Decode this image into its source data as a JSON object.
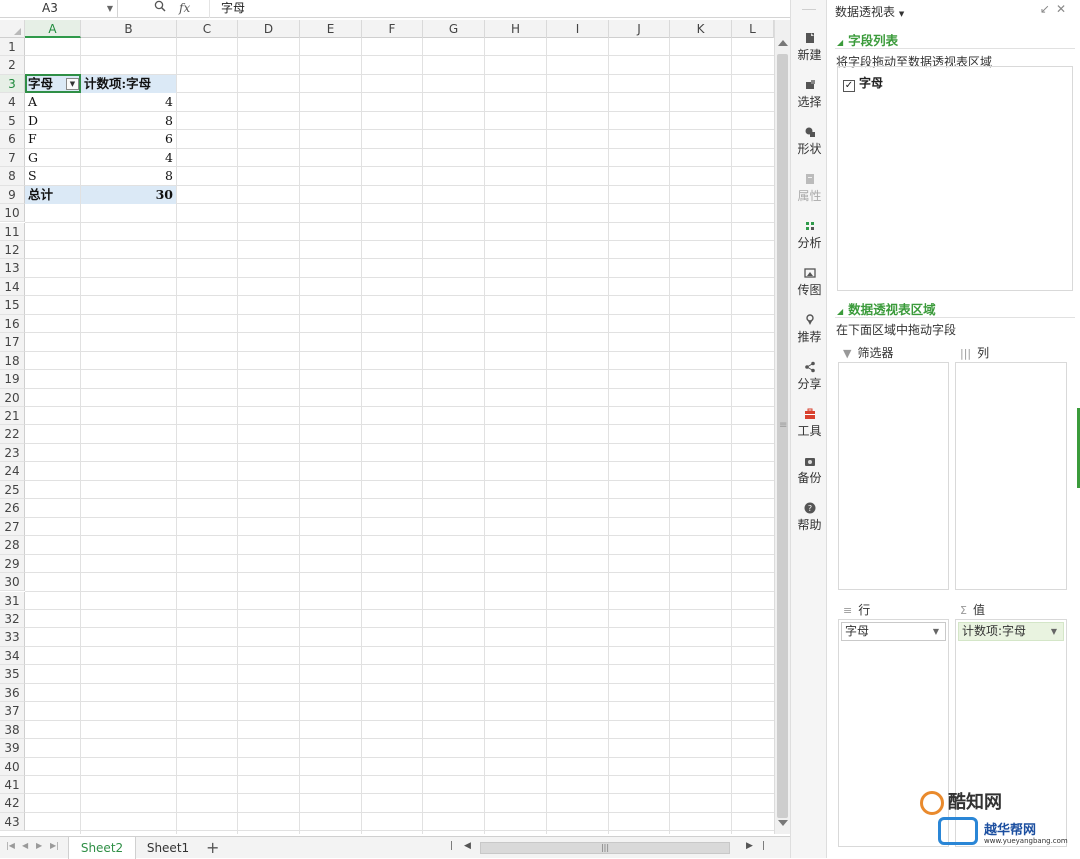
{
  "formula_bar": {
    "name_box": "A3",
    "zoom_icon": "zoom-icon",
    "fx_label": "fx",
    "formula_value": "字母"
  },
  "columns": [
    "A",
    "B",
    "C",
    "D",
    "E",
    "F",
    "G",
    "H",
    "I",
    "J",
    "K",
    "L"
  ],
  "rows": [
    "1",
    "2",
    "3",
    "4",
    "5",
    "6",
    "7",
    "8",
    "9",
    "10",
    "11",
    "12",
    "13",
    "14",
    "15",
    "16",
    "17",
    "18",
    "19",
    "20",
    "21",
    "22",
    "23",
    "24",
    "25",
    "26",
    "27",
    "28",
    "29",
    "30",
    "31",
    "32",
    "33",
    "34",
    "35",
    "36",
    "37",
    "38",
    "39",
    "40",
    "41",
    "42",
    "43"
  ],
  "active_cell": {
    "column": "A",
    "row": "3"
  },
  "pivot_table": {
    "header_row_label": "字母",
    "header_value_label": "计数项:字母",
    "rows": [
      {
        "label": "A",
        "count": "4"
      },
      {
        "label": "D",
        "count": "8"
      },
      {
        "label": "F",
        "count": "6"
      },
      {
        "label": "G",
        "count": "4"
      },
      {
        "label": "S",
        "count": "8"
      }
    ],
    "total_label": "总计",
    "total_value": "30"
  },
  "sheet_tabs": [
    {
      "label": "Sheet2",
      "active": true
    },
    {
      "label": "Sheet1",
      "active": false
    }
  ],
  "add_sheet_label": "+",
  "side_toolbar": [
    {
      "label": "新建",
      "icon": "file-icon",
      "enabled": true
    },
    {
      "label": "选择",
      "icon": "select-icon",
      "enabled": true
    },
    {
      "label": "形状",
      "icon": "shapes-icon",
      "enabled": true
    },
    {
      "label": "属性",
      "icon": "properties-icon",
      "enabled": false
    },
    {
      "label": "分析",
      "icon": "analysis-icon",
      "enabled": true
    },
    {
      "label": "传图",
      "icon": "image-upload-icon",
      "enabled": true
    },
    {
      "label": "推荐",
      "icon": "recommend-icon",
      "enabled": true
    },
    {
      "label": "分享",
      "icon": "share-icon",
      "enabled": true
    },
    {
      "label": "工具",
      "icon": "toolbox-icon",
      "enabled": true
    },
    {
      "label": "备份",
      "icon": "backup-icon",
      "enabled": true
    },
    {
      "label": "帮助",
      "icon": "help-icon",
      "enabled": true
    }
  ],
  "pivot_panel": {
    "title": "数据透视表",
    "field_list_title": "字段列表",
    "field_list_desc": "将字段拖动至数据透视表区域",
    "fields": [
      {
        "label": "字母",
        "checked": true
      }
    ],
    "areas_title": "数据透视表区域",
    "areas_desc": "在下面区域中拖动字段",
    "filter_label": "筛选器",
    "columns_label": "列",
    "rows_label": "行",
    "values_label": "值",
    "row_field": "字母",
    "value_field": "计数项:字母"
  },
  "watermarks": {
    "brand1": "酷知网",
    "brand2": "越华帮网",
    "brand2_url": "www.yueyangbang.com"
  },
  "colors": {
    "accent_green": "#3b9b3b",
    "pivot_header_bg": "#dbe9f6",
    "selection_border": "#2f8f46"
  }
}
